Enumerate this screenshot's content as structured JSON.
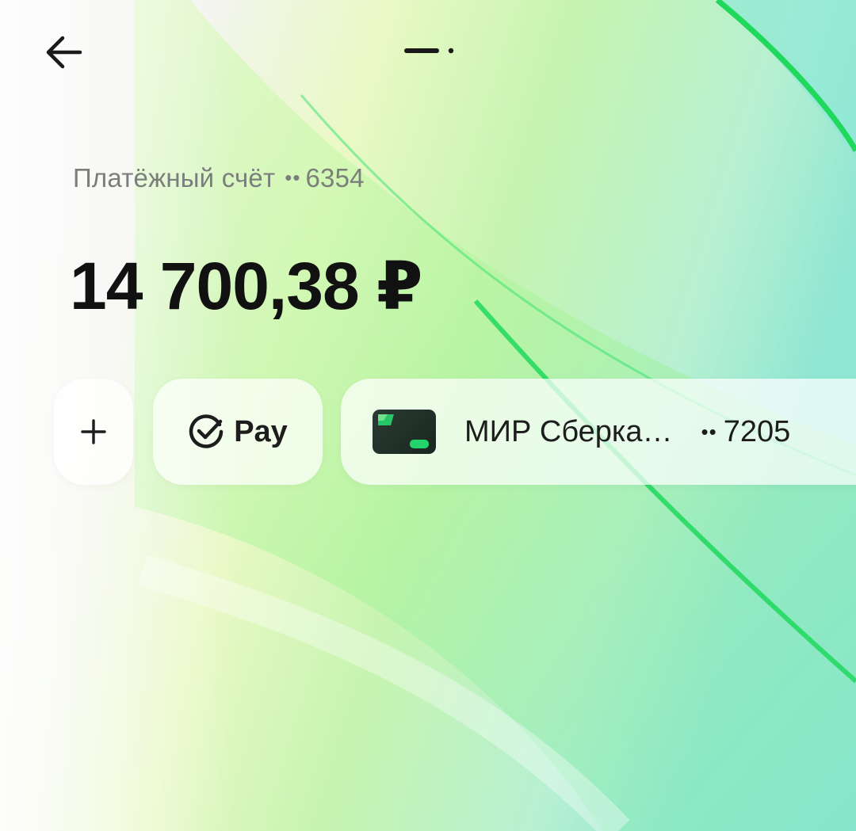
{
  "colors": {
    "accent_green": "#21c35a",
    "text_primary": "#111111",
    "text_secondary": "#7b7f7c"
  },
  "header": {
    "back_icon": "arrow-left-icon",
    "page_indicator_icon": "page-indicator-icon"
  },
  "account": {
    "label": "Платёжный счёт",
    "masked_prefix": "••",
    "number_suffix": "6354"
  },
  "balance": {
    "amount": "14 700,38 ₽"
  },
  "actions": {
    "add_label": "+",
    "pay_icon": "check-circle-icon",
    "pay_label": "Pay"
  },
  "card": {
    "icon": "bank-card-icon",
    "name": "МИР Сберка…",
    "masked_prefix": "••",
    "number_suffix": "7205"
  }
}
